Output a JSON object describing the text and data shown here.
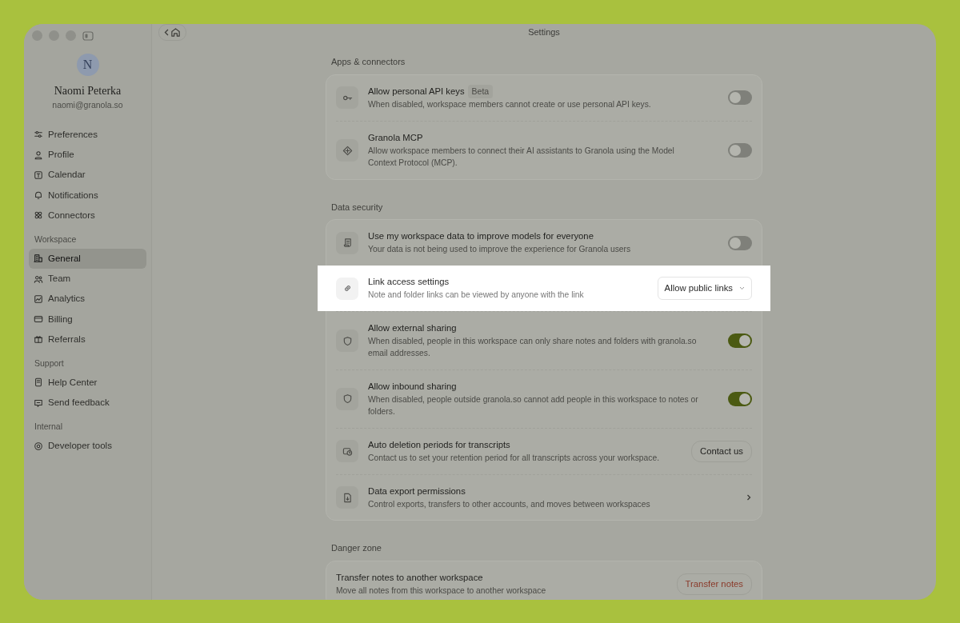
{
  "window": {
    "title": "Settings"
  },
  "user": {
    "initial": "N",
    "name": "Naomi Peterka",
    "email": "naomi@granola.so"
  },
  "sidebar": {
    "groups": [
      {
        "items": [
          {
            "label": "Preferences",
            "selected": false
          },
          {
            "label": "Profile",
            "selected": false
          },
          {
            "label": "Calendar",
            "selected": false
          },
          {
            "label": "Notifications",
            "selected": false
          },
          {
            "label": "Connectors",
            "selected": false
          }
        ]
      },
      {
        "heading": "Workspace",
        "items": [
          {
            "label": "General",
            "selected": true
          },
          {
            "label": "Team",
            "selected": false
          },
          {
            "label": "Analytics",
            "selected": false
          },
          {
            "label": "Billing",
            "selected": false
          },
          {
            "label": "Referrals",
            "selected": false
          }
        ]
      },
      {
        "heading": "Support",
        "items": [
          {
            "label": "Help Center",
            "selected": false
          },
          {
            "label": "Send feedback",
            "selected": false
          }
        ]
      },
      {
        "heading": "Internal",
        "items": [
          {
            "label": "Developer tools",
            "selected": false
          }
        ]
      }
    ]
  },
  "sections": [
    {
      "heading": "Apps & connectors",
      "rows": [
        {
          "kind": "toggle",
          "title": "Allow personal API keys",
          "badge": "Beta",
          "description": "When disabled, workspace members cannot create or use personal API keys.",
          "on": false,
          "highlighted": false
        },
        {
          "kind": "toggle",
          "title": "Granola MCP",
          "description": "Allow workspace members to connect their AI assistants to Granola using the Model Context Protocol (MCP).",
          "on": false,
          "highlighted": false
        }
      ]
    },
    {
      "heading": "Data security",
      "rows": [
        {
          "kind": "toggle",
          "title": "Use my workspace data to improve models for everyone",
          "description": "Your data is not being used to improve the experience for Granola users",
          "on": false,
          "highlighted": false
        },
        {
          "kind": "select",
          "title": "Link access settings",
          "description": "Note and folder links can be viewed by anyone with the link",
          "value": "Allow public links",
          "highlighted": true
        },
        {
          "kind": "toggle",
          "title": "Allow external sharing",
          "description": "When disabled, people in this workspace can only share notes and folders with granola.so email addresses.",
          "on": true,
          "highlighted": false
        },
        {
          "kind": "toggle",
          "title": "Allow inbound sharing",
          "description": "When disabled, people outside granola.so cannot add people in this workspace to notes or folders.",
          "on": true,
          "highlighted": false
        },
        {
          "kind": "button",
          "title": "Auto deletion periods for transcripts",
          "description": "Contact us to set your retention period for all transcripts across your workspace.",
          "button": "Contact us",
          "highlighted": false
        },
        {
          "kind": "chevron",
          "title": "Data export permissions",
          "description": "Control exports, transfers to other accounts, and moves between workspaces",
          "highlighted": false
        }
      ]
    },
    {
      "heading": "Danger zone",
      "rows": [
        {
          "kind": "danger_button",
          "title": "Transfer notes to another workspace",
          "description": "Move all notes from this workspace to another workspace",
          "button": "Transfer notes",
          "highlighted": false
        }
      ]
    }
  ]
}
